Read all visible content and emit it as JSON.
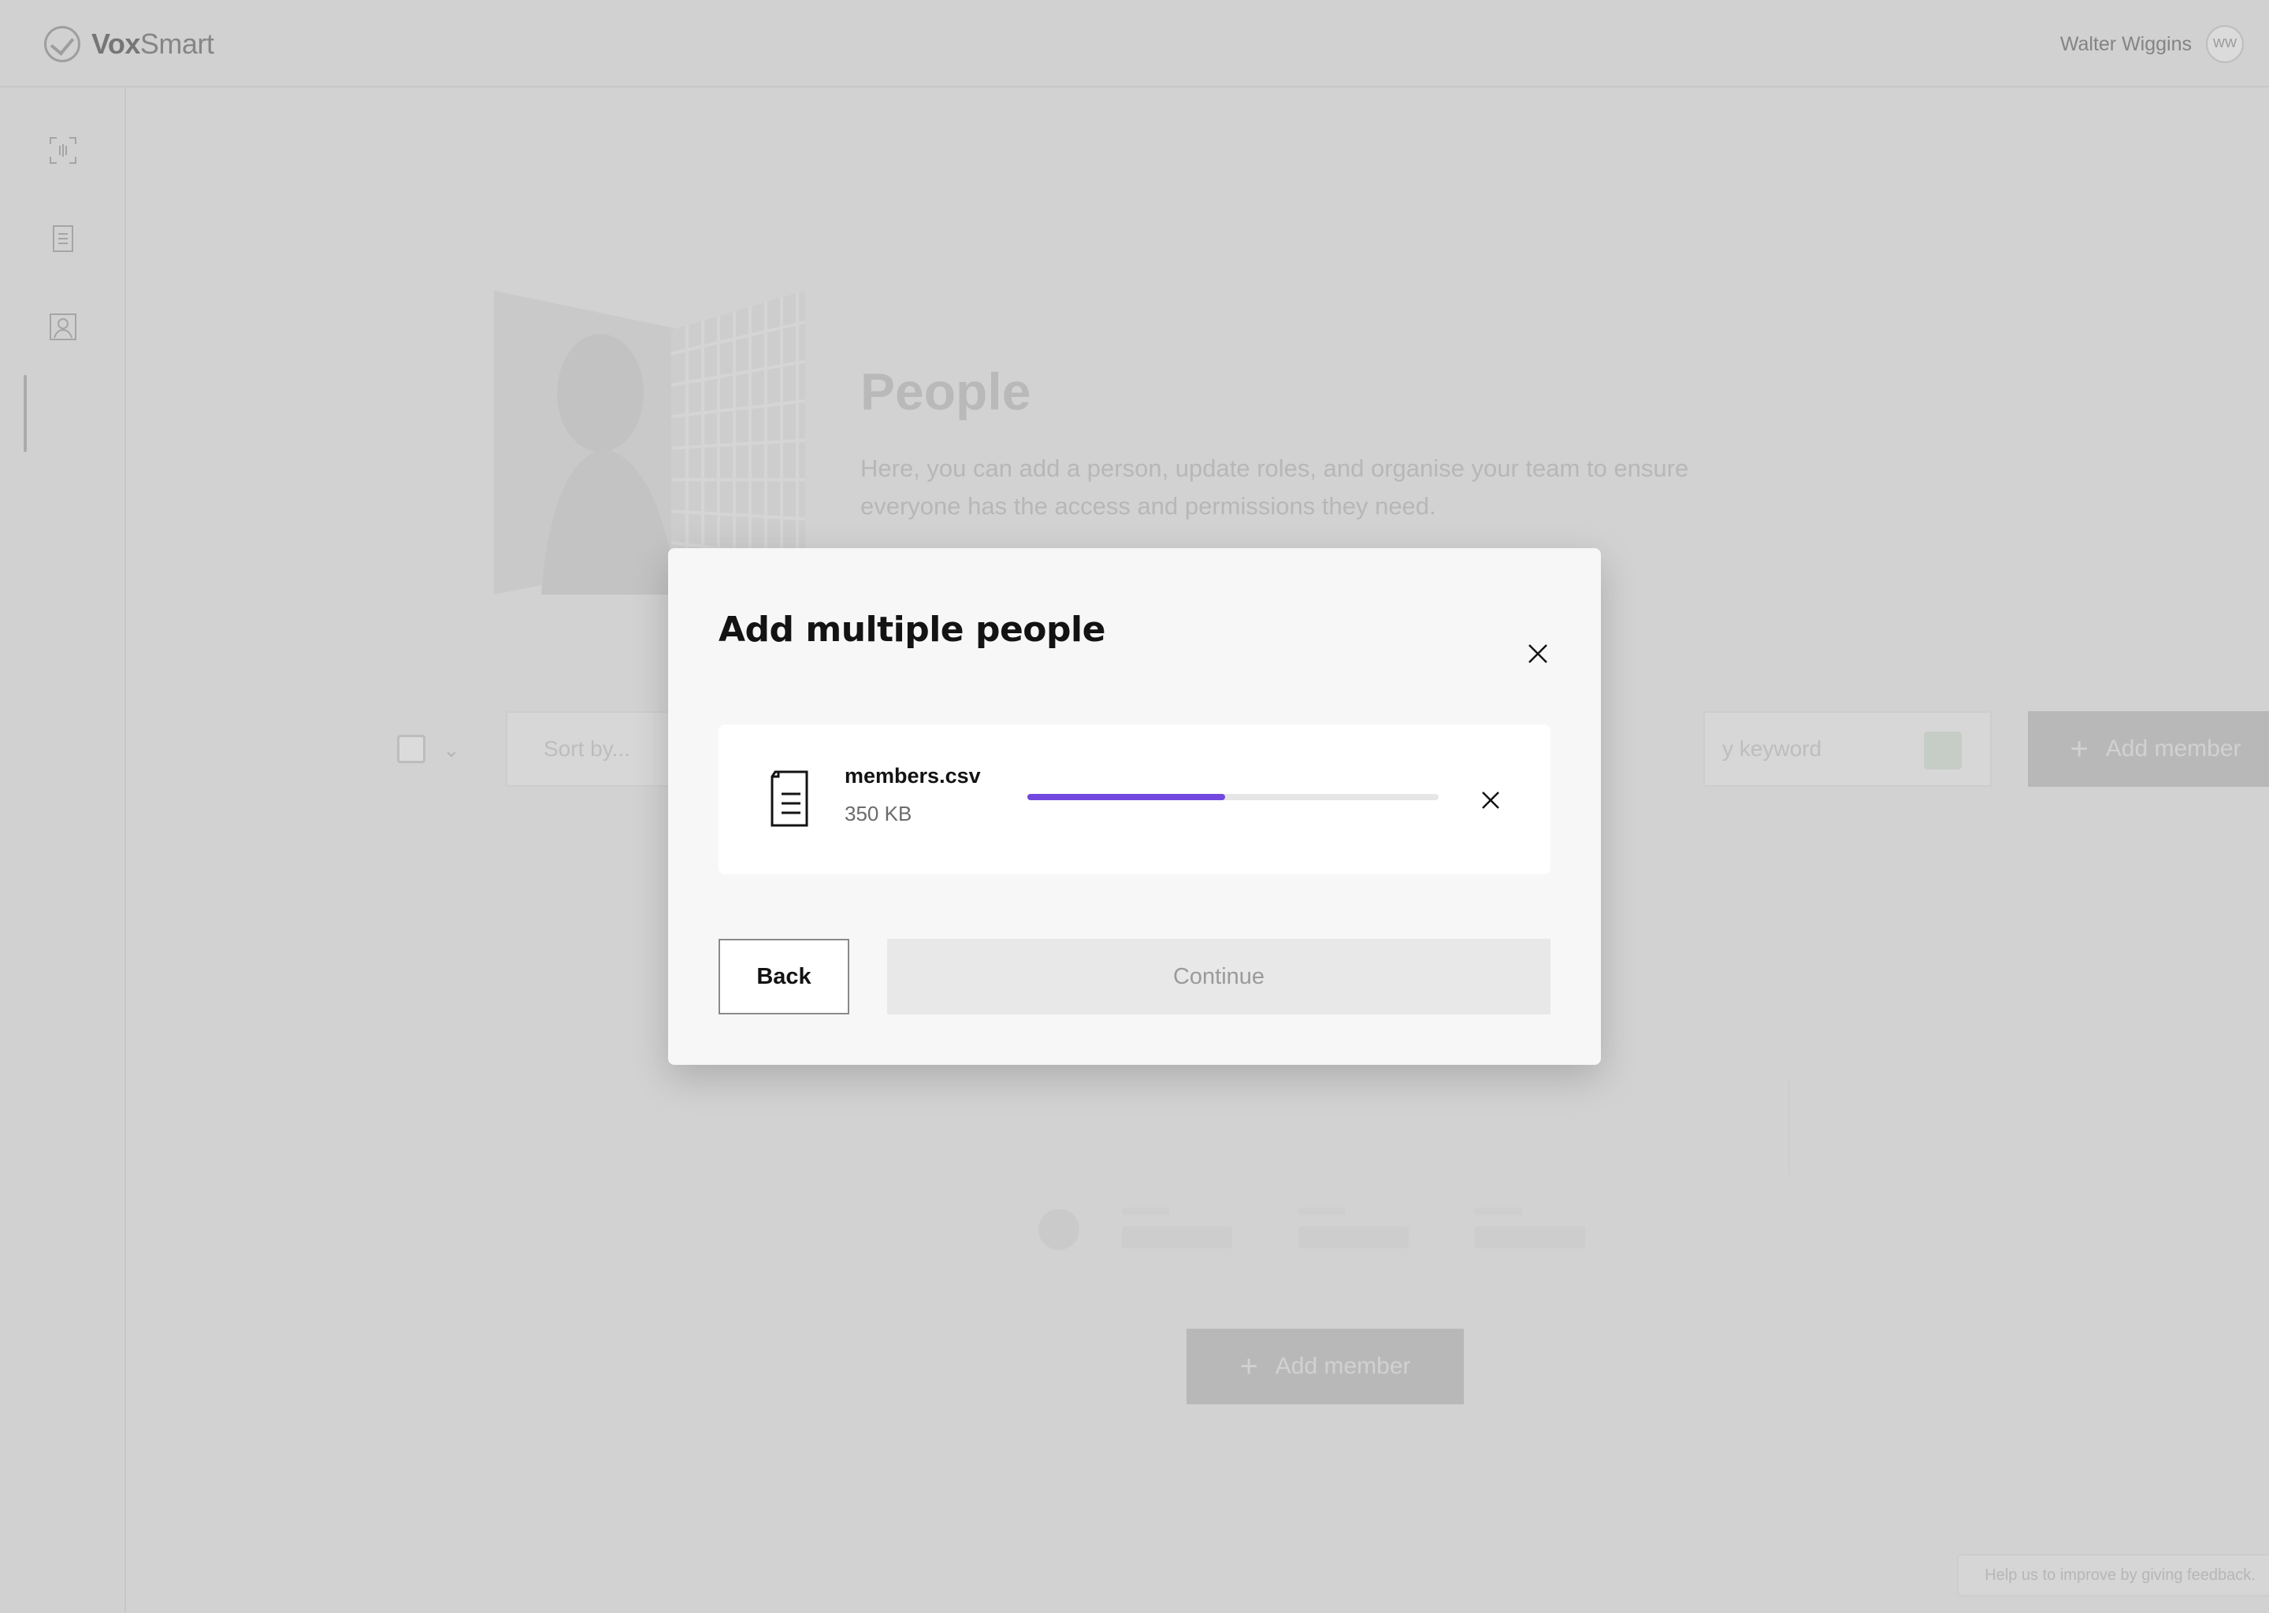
{
  "app": {
    "brand_bold": "Vox",
    "brand_light": "Smart",
    "user_name": "Walter Wiggins",
    "user_initials": "WW"
  },
  "sidebar": {
    "items": [
      {
        "icon": "scan-icon",
        "active": false
      },
      {
        "icon": "document-icon",
        "active": false
      },
      {
        "icon": "people-icon",
        "active": true
      }
    ]
  },
  "page": {
    "title": "People",
    "description": "Here, you can add a person, update roles, and organise your team to ensure everyone has the access and permissions they need."
  },
  "toolbar": {
    "sort_label": "Sort by...",
    "search_placeholder": "y keyword",
    "add_member_label": "Add member"
  },
  "empty_state": {
    "add_member_label": "Add member"
  },
  "feedback": {
    "text": "Help us to improve by giving feedback."
  },
  "modal": {
    "title": "Add multiple people",
    "file": {
      "name": "members.csv",
      "size": "350 KB",
      "upload_progress": 0.48
    },
    "back_label": "Back",
    "continue_label": "Continue"
  },
  "colors": {
    "accent": "#7248df",
    "text_dark": "#131313"
  }
}
